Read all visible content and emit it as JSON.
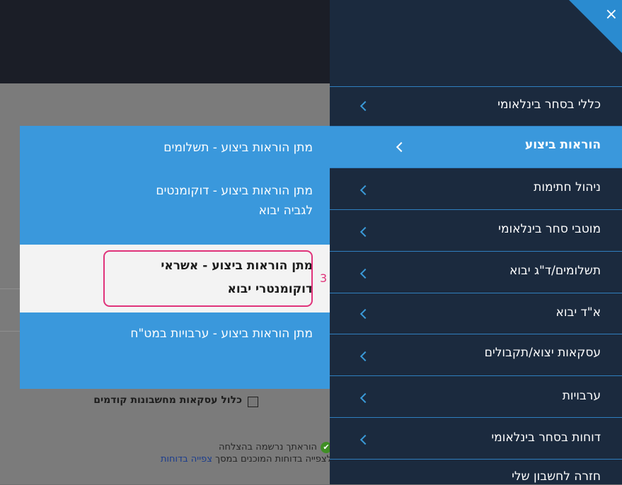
{
  "main": {
    "checkbox_label": "כלול עסקאות מחשבונות קודמים",
    "success_message": "הוראתך נרשמה בהצלחה",
    "reports_prefix": "לצפייה בדוחות המוכנים במסך",
    "reports_link": "צפייה בדוחות"
  },
  "menu": {
    "close_glyph": "×",
    "items": [
      {
        "label": "כללי בסחר בינלאומי"
      },
      {
        "label": "הוראות ביצוע"
      },
      {
        "label": "ניהול חתימות"
      },
      {
        "label": "מוטבי סחר בינלאומי"
      },
      {
        "label": "תשלומים/ד\"ג יבוא"
      },
      {
        "label": "א\"ד יבוא"
      },
      {
        "label": "עסקאות יצוא/תקבולים"
      },
      {
        "label": "ערבויות"
      },
      {
        "label": "דוחות בסחר בינלאומי"
      },
      {
        "label": "חזרה לחשבון שלי"
      }
    ]
  },
  "submenu": {
    "items": [
      {
        "label": "מתן הוראות ביצוע - תשלומים"
      },
      {
        "label": "מתן הוראות ביצוע - דוקומנטים לגביה יבוא"
      },
      {
        "label": "מתן הוראות ביצוע - אשראי דוקומנטרי יבוא"
      },
      {
        "label": "מתן הוראות ביצוע - ערבויות במט\"ח"
      }
    ]
  },
  "annotation": {
    "number": "3"
  },
  "colors": {
    "accent": "#3a98dc",
    "panel": "#1b2a3e",
    "highlight": "#e0337a"
  }
}
